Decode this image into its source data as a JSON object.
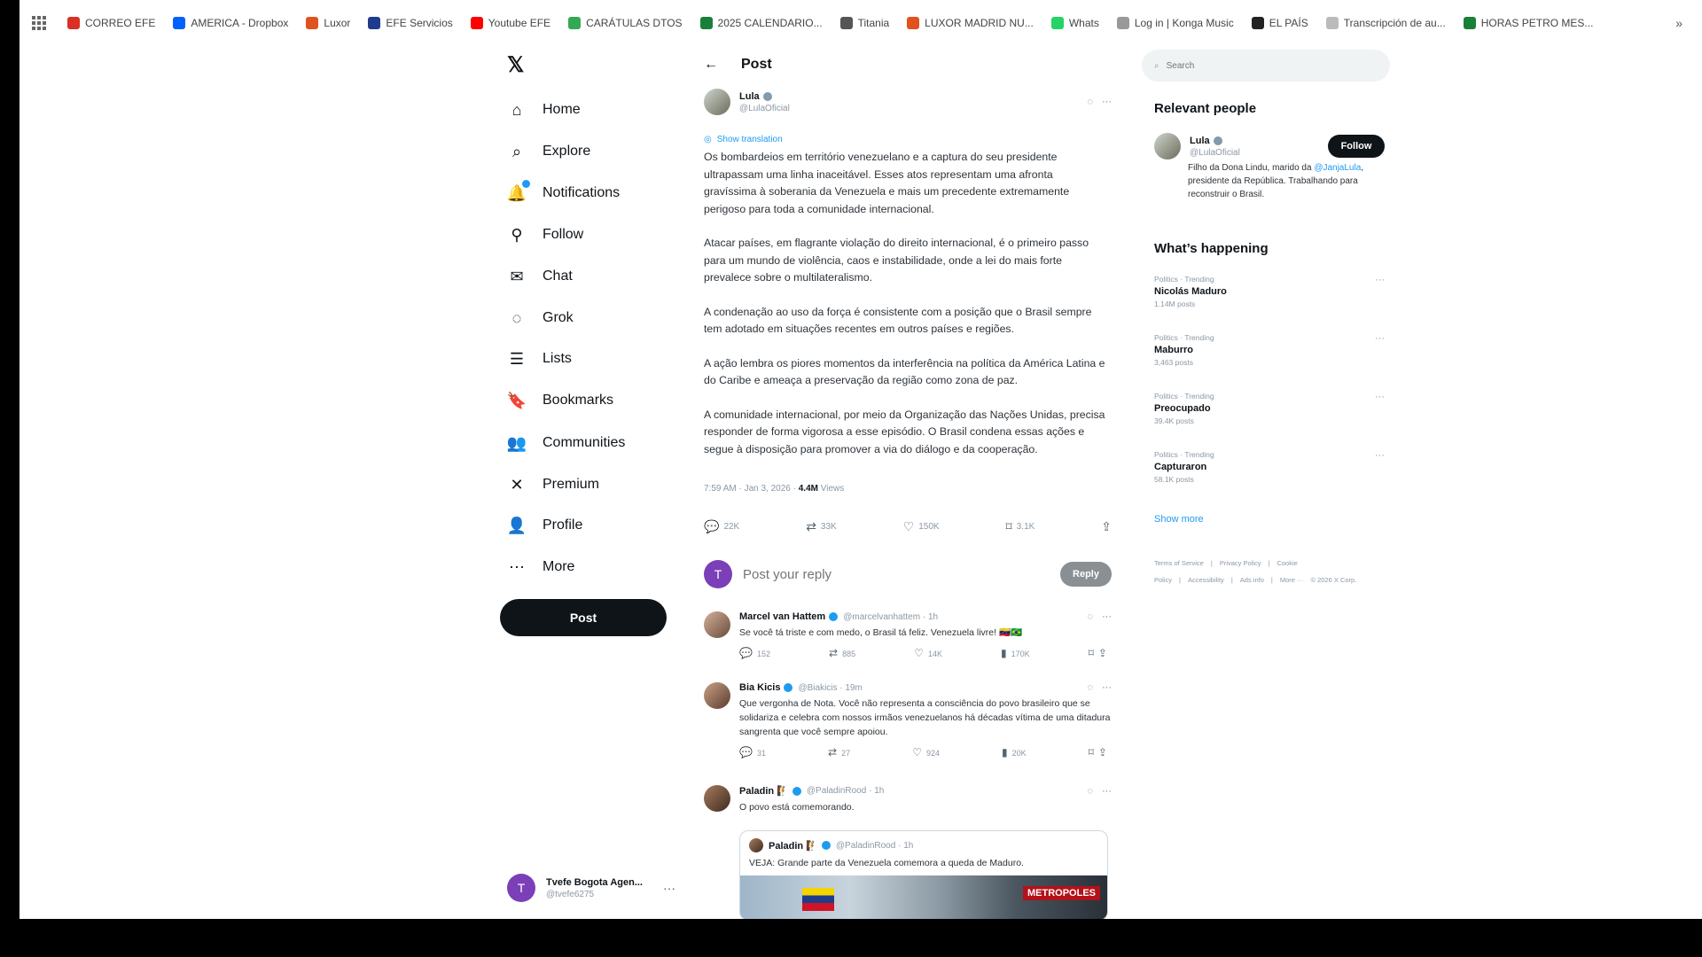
{
  "bookmarks": [
    {
      "label": "CORREO EFE",
      "color": "#d93025"
    },
    {
      "label": "AMERICA - Dropbox",
      "color": "#0061fe"
    },
    {
      "label": "Luxor",
      "color": "#e0531d"
    },
    {
      "label": "EFE Servicios",
      "color": "#1f3b8c"
    },
    {
      "label": "Youtube EFE",
      "color": "#ff0000"
    },
    {
      "label": "CARÁTULAS DTOS",
      "color": "#34a853"
    },
    {
      "label": "2025 CALENDARIO...",
      "color": "#188038"
    },
    {
      "label": "Titania",
      "color": "#555555"
    },
    {
      "label": "LUXOR MADRID NU...",
      "color": "#e0531d"
    },
    {
      "label": "Whats",
      "color": "#25d366"
    },
    {
      "label": "Log in | Konga Music",
      "color": "#999999"
    },
    {
      "label": "EL PAÍS",
      "color": "#222222"
    },
    {
      "label": "Transcripción de au...",
      "color": "#bbbbbb"
    },
    {
      "label": "HORAS PETRO MES...",
      "color": "#188038"
    }
  ],
  "bookmarks_more": "»",
  "nav": {
    "items": [
      {
        "label": "Home",
        "icon": "home-icon",
        "glyph": "⌂"
      },
      {
        "label": "Explore",
        "icon": "search-icon",
        "glyph": "⌕"
      },
      {
        "label": "Notifications",
        "icon": "bell-icon",
        "glyph": "🔔"
      },
      {
        "label": "Follow",
        "icon": "follow-icon",
        "glyph": "⚲"
      },
      {
        "label": "Chat",
        "icon": "mail-icon",
        "glyph": "✉"
      },
      {
        "label": "Grok",
        "icon": "grok-icon",
        "glyph": "◌"
      },
      {
        "label": "Lists",
        "icon": "list-icon",
        "glyph": "☰"
      },
      {
        "label": "Bookmarks",
        "icon": "bookmark-icon",
        "glyph": "🔖"
      },
      {
        "label": "Communities",
        "icon": "communities-icon",
        "glyph": "👥"
      },
      {
        "label": "Premium",
        "icon": "x-premium-icon",
        "glyph": "✕"
      },
      {
        "label": "Profile",
        "icon": "person-icon",
        "glyph": "👤"
      },
      {
        "label": "More",
        "icon": "more-circle-icon",
        "glyph": "⋯"
      }
    ],
    "post_button": "Post",
    "account": {
      "avatar_letter": "T",
      "name": "Tvefe Bogota Agen...",
      "handle": "@tvefe6275"
    }
  },
  "main": {
    "title": "Post",
    "author": {
      "name": "Lula",
      "handle": "@LulaOficial"
    },
    "show_translation": "Show translation",
    "paragraphs": [
      "Os bombardeios em território venezuelano e a captura do seu presidente ultrapassam uma linha inaceitável. Esses atos representam uma afronta gravíssima à soberania da Venezuela e mais um precedente extremamente perigoso para toda a comunidade internacional.",
      "Atacar países, em flagrante violação do direito internacional, é o primeiro passo para um mundo de violência, caos e instabilidade, onde a lei do mais forte prevalece sobre o multilateralismo.",
      "A condenação ao uso da força é consistente com a posição que o Brasil sempre tem adotado em situações recentes em outros países e regiões.",
      "A ação lembra os piores momentos da interferência na política da América Latina e do Caribe e ameaça a preservação da região como zona de paz.",
      "A comunidade internacional, por meio da Organização das Nações Unidas, precisa responder de forma vigorosa a esse episódio. O Brasil condena essas ações e segue à disposição para promover a via do diálogo e da cooperação."
    ],
    "meta_time": "7:59 AM · Jan 3, 2026 · ",
    "meta_views": "4.4M",
    "meta_views_label": " Views",
    "stats": {
      "replies": "22K",
      "reposts": "33K",
      "likes": "150K",
      "bookmarks": "3.1K"
    },
    "reply_avatar_letter": "T",
    "reply_placeholder": "Post your reply",
    "reply_button": "Reply",
    "replies": [
      {
        "name": "Marcel van Hattem",
        "handle": "@marcelvanhattem · 1h",
        "text": "Se você tá triste e com medo, o Brasil tá feliz. Venezuela livre! 🇻🇪🇧🇷",
        "stats": {
          "replies": "152",
          "reposts": "885",
          "likes": "14K",
          "views": "170K"
        }
      },
      {
        "name": "Bia Kicis",
        "handle": "@Biakicis · 19m",
        "text": "Que vergonha de Nota. Você não representa a consciência do povo brasileiro que se solidariza e celebra com nossos irmãos venezuelanos há décadas vítima de uma ditadura sangrenta que você sempre apoiou.",
        "stats": {
          "replies": "31",
          "reposts": "27",
          "likes": "924",
          "views": "20K"
        }
      },
      {
        "name": "Paladin 🧗",
        "handle": "@PaladinRood · 1h",
        "text": "O povo está comemorando.",
        "quote": {
          "name": "Paladin 🧗",
          "handle": "@PaladinRood · 1h",
          "text": "VEJA: Grande parte da Venezuela comemora a queda de Maduro.",
          "media_label": "METROPOLES"
        }
      }
    ]
  },
  "right": {
    "search_placeholder": "Search",
    "relevant_title": "Relevant people",
    "relevant": {
      "name": "Lula",
      "handle": "@LulaOficial",
      "follow": "Follow",
      "bio_start": "Filho da Dona Lindu, marido da ",
      "bio_link": "@JanjaLula",
      "bio_end": ", presidente da República. Trabalhando para reconstruir o Brasil."
    },
    "happening_title": "What’s happening",
    "trends": [
      {
        "category": "Politics · Trending",
        "name": "Nicolás Maduro",
        "count": "1.14M posts"
      },
      {
        "category": "Politics · Trending",
        "name": "Maburro",
        "count": "3,463 posts"
      },
      {
        "category": "Politics · Trending",
        "name": "Preocupado",
        "count": "39.4K posts"
      },
      {
        "category": "Politics · Trending",
        "name": "Capturaron",
        "count": "58.1K posts"
      }
    ],
    "show_more": "Show more",
    "footer": [
      "Terms of Service",
      "|",
      "Privacy Policy",
      "|",
      "Cookie Policy",
      "|",
      "Accessibility",
      "|",
      "Ads info",
      "|",
      "More ···",
      "© 2026 X Corp."
    ]
  },
  "colors": {
    "accent": "#1d9bf0",
    "text": "#0f1419",
    "muted": "#8b98a5"
  }
}
